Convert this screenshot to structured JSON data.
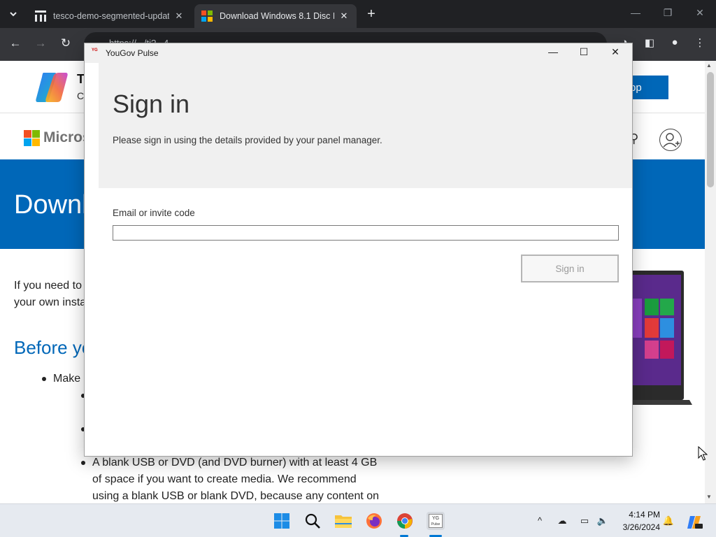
{
  "browser": {
    "tabs": [
      {
        "title": "tesco-demo-segmented-updat",
        "close": "✕"
      },
      {
        "title": "Download Windows 8.1 Disc Im",
        "close": "✕"
      }
    ],
    "url": "https://.../ti?...4",
    "new_tab": "+"
  },
  "page": {
    "copilot_title": "T",
    "copilot_subtitle": "C",
    "get_app_label": "ot app",
    "ms_brand": "Micros",
    "hero_title": "Downl",
    "intro_line1": "If you need to",
    "intro_line2": "your own insta",
    "before_heading": "Before yo",
    "bullet_make": "Make",
    "bullet_usb_1": "A blank USB or DVD (and DVD burner) with at least 4 GB",
    "bullet_usb_2": "of space if you want to create media. We recommend",
    "bullet_usb_3": "using a blank USB or blank DVD, because any content on"
  },
  "dialog": {
    "app_icon_text": "YG",
    "window_title": "YouGov Pulse",
    "heading": "Sign in",
    "subtitle": "Please sign in using the details provided by your panel manager.",
    "field_label": "Email or invite code",
    "field_value": "",
    "field_placeholder": "",
    "signin_button": "Sign in"
  },
  "taskbar": {
    "apps": [
      "start",
      "search",
      "file-explorer",
      "firefox",
      "chrome",
      "yougov-pulse"
    ],
    "yougov_label": "YG",
    "yougov_sub": "Pulse",
    "clock_time": "4:14 PM",
    "clock_date": "3/26/2024"
  },
  "colors": {
    "ms_blue": "#0067b8",
    "win_accent": "#0078d4"
  }
}
